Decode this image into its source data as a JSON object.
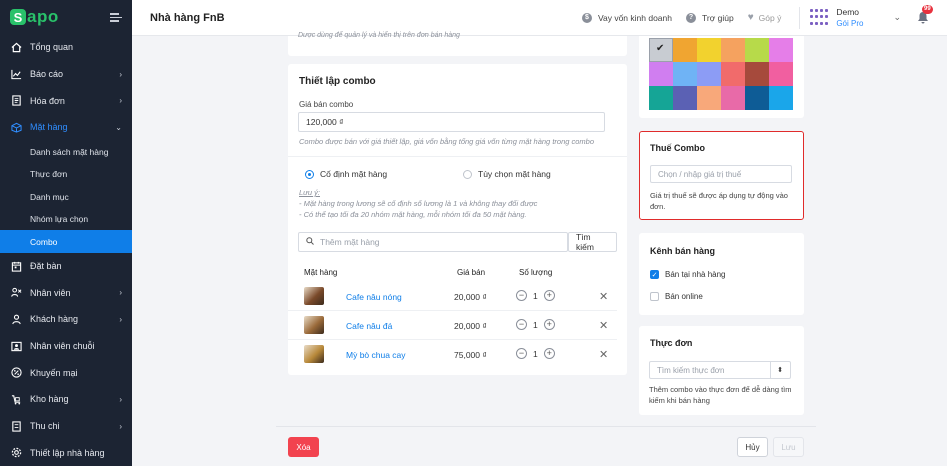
{
  "logo": {
    "mark": "S",
    "text": "apo"
  },
  "sidebar": {
    "items": [
      {
        "label": "Tổng quan",
        "icon": "home-icon",
        "chevron": ""
      },
      {
        "label": "Báo cáo",
        "icon": "chart-icon",
        "chevron": "›"
      },
      {
        "label": "Hóa đơn",
        "icon": "invoice-icon",
        "chevron": "›"
      },
      {
        "label": "Mặt hàng",
        "icon": "box-icon",
        "chevron": "⌄"
      }
    ],
    "subitems": [
      {
        "label": "Danh sách mặt hàng"
      },
      {
        "label": "Thực đơn"
      },
      {
        "label": "Danh mục"
      },
      {
        "label": "Nhóm lựa chọn"
      },
      {
        "label": "Combo"
      }
    ],
    "items_after": [
      {
        "label": "Đặt bàn",
        "icon": "calendar-icon",
        "chevron": ""
      },
      {
        "label": "Nhân viên",
        "icon": "staff-icon",
        "chevron": "›"
      },
      {
        "label": "Khách hàng",
        "icon": "customer-icon",
        "chevron": "›"
      },
      {
        "label": "Nhân viên chuỗi",
        "icon": "chain-staff-icon",
        "chevron": ""
      },
      {
        "label": "Khuyến mại",
        "icon": "promotion-icon",
        "chevron": ""
      },
      {
        "label": "Kho hàng",
        "icon": "warehouse-icon",
        "chevron": "›"
      },
      {
        "label": "Thu chi",
        "icon": "cashbook-icon",
        "chevron": "›"
      },
      {
        "label": "Thiết lập nhà hàng",
        "icon": "settings-icon",
        "chevron": ""
      }
    ]
  },
  "header": {
    "title": "Nhà hàng FnB",
    "loan": "Vay vốn kinh doanh",
    "help": "Trợ giúp",
    "feedback": "Góp ý",
    "user_name": "Demo",
    "user_plan": "Gói Pro",
    "notif_count": "99"
  },
  "top_hint": "Dược dùng để quản lý và hiển thị trên đơn bán hàng",
  "combo": {
    "title": "Thiết lập combo",
    "price_label": "Giá bán combo",
    "price_value": "120,000 ₫",
    "price_hint": "Combo được bán với giá thiết lập, giá vốn bằng tổng giá vốn từng mặt hàng trong combo",
    "radio_fixed": "Cố định mặt hàng",
    "radio_optional": "Tùy chọn mặt hàng",
    "note_title": "Lưu ý:",
    "note_1": "- Mặt hàng trong lương sẽ cố định số lương là 1 và không thay đổi được",
    "note_2": "- Có thể tạo tối đa 20 nhóm mặt hàng, mỗi nhóm tối đa 50 mặt hàng.",
    "search_placeholder": "Thêm mặt hàng",
    "search_button": "Tìm kiếm",
    "columns": {
      "item": "Mặt hàng",
      "price": "Giá bán",
      "qty": "Số lượng"
    },
    "rows": [
      {
        "name": "Cafe nâu nóng",
        "price": "20,000 ₫",
        "qty": "1",
        "color": "#7a4a2a"
      },
      {
        "name": "Cafe nâu đá",
        "price": "20,000 ₫",
        "qty": "1",
        "color": "#9a6a3a"
      },
      {
        "name": "Mỳ bò chua cay",
        "price": "75,000 ₫",
        "qty": "1",
        "color": "#b8893a"
      }
    ]
  },
  "colors": {
    "swatches": [
      "#c8ccd2",
      "#f0a531",
      "#f2d22e",
      "#f5a25f",
      "#b7da4a",
      "#e57ee8",
      "#d07ef0",
      "#6fb3f5",
      "#8c9cf5",
      "#f16b6b",
      "#a64a3c",
      "#f15fa0",
      "#15a596",
      "#5b61b4",
      "#f8a87a",
      "#e86aa8",
      "#0e5c96",
      "#1aa6ea"
    ],
    "accent": "#0f7ee8",
    "danger": "#f2434f"
  },
  "tax": {
    "title": "Thuế Combo",
    "placeholder": "Chọn / nhập giá trị thuế",
    "hint": "Giá trị thuế sẽ được áp dụng tự động vào đơn."
  },
  "channel": {
    "title": "Kênh bán hàng",
    "opt1": "Bán tại nhà hàng",
    "opt2": "Bán online"
  },
  "menu": {
    "title": "Thực đơn",
    "placeholder": "Tìm kiếm thực đơn",
    "hint": "Thêm combo vào thực đơn để dễ dàng tìm kiếm khi bán hàng"
  },
  "footer": {
    "delete": "Xóa",
    "cancel": "Hủy",
    "save": "Lưu"
  }
}
